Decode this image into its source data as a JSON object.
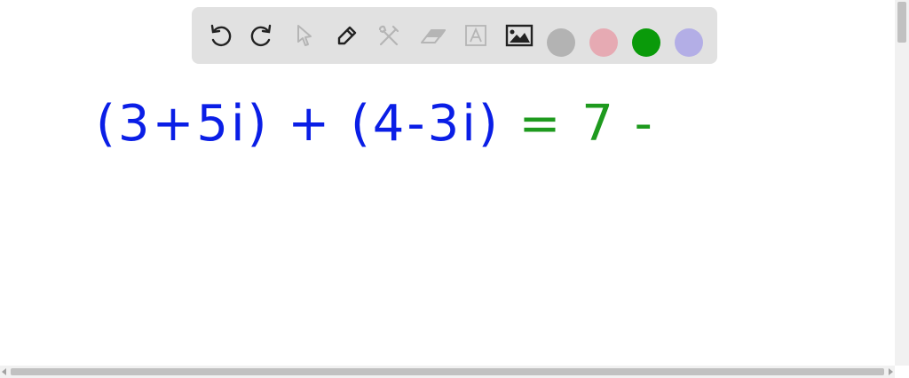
{
  "toolbar": {
    "tools": [
      {
        "name": "undo-icon",
        "enabled": true
      },
      {
        "name": "redo-icon",
        "enabled": true
      },
      {
        "name": "select-pointer-icon",
        "enabled": false
      },
      {
        "name": "pen-icon",
        "enabled": true
      },
      {
        "name": "tools-icon",
        "enabled": false
      },
      {
        "name": "eraser-icon",
        "enabled": false
      },
      {
        "name": "text-icon",
        "enabled": false
      },
      {
        "name": "image-icon",
        "enabled": true
      }
    ],
    "colors": [
      "#b3b3b3",
      "#e6aab3",
      "#0a9a0a",
      "#b3aee6"
    ],
    "selected_color": "#0a9a0a"
  },
  "canvas": {
    "handwriting": "(3+5i) + (4-3i) = 7 -",
    "ink_colors": {
      "expression": "#0a1ee6",
      "answer": "#1e9a1e"
    }
  }
}
